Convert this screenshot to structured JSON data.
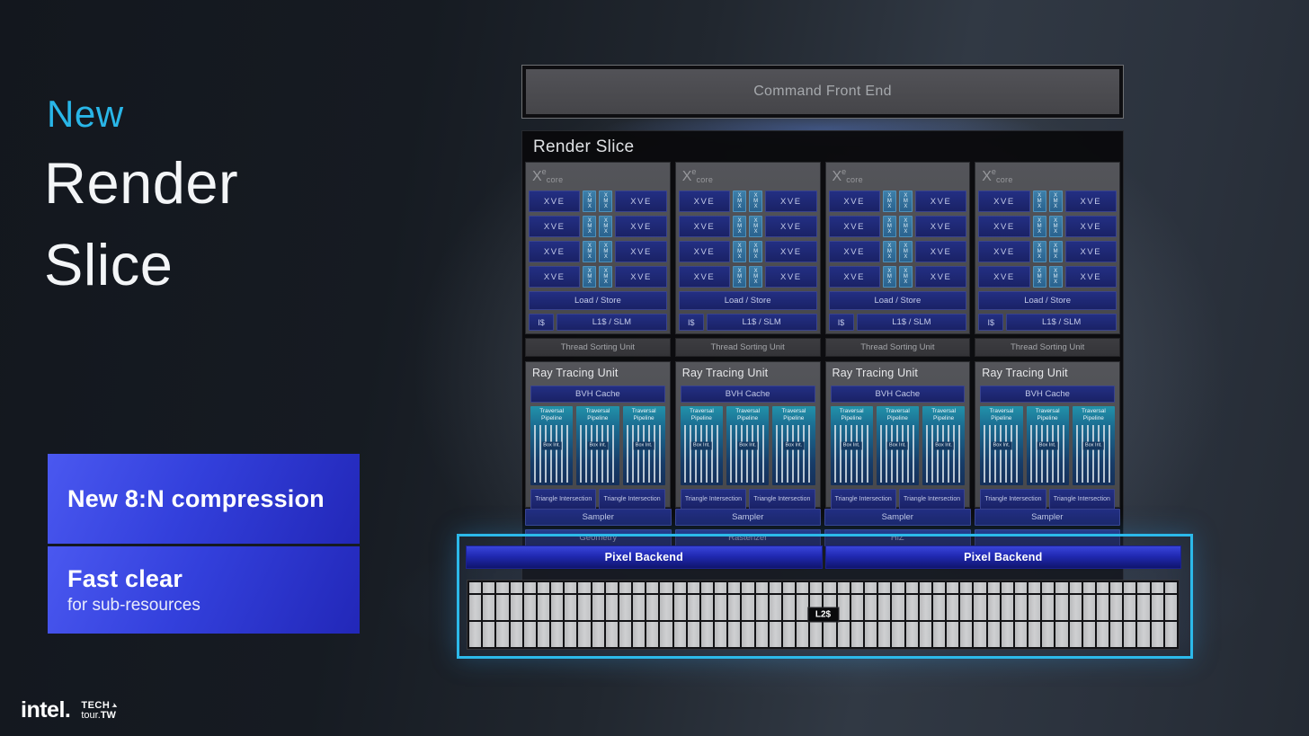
{
  "slide": {
    "eyebrow": "New",
    "title_line1": "Render",
    "title_line2": "Slice",
    "callouts": [
      {
        "title": "New 8:N compression"
      },
      {
        "title": "Fast clear",
        "subtitle": "for sub-resources"
      }
    ],
    "footer": {
      "intel_logo": "intel.",
      "tech": "TECH",
      "tour": "tour.",
      "tw": "TW"
    }
  },
  "colors": {
    "accent_cyan": "#29b6e8",
    "highlight_border": "#2cb9ea",
    "callout_blue_start": "#4a58f0",
    "callout_blue_end": "#2227b8",
    "unit_navy": "#1c2a74",
    "xmx_teal": "#34719d",
    "pipeline_teal": "#1b6d92",
    "pixel_backend_blue": "#2630bc",
    "l2_cell_gray": "#c6c7c9",
    "block_gray": "#4d4e52"
  },
  "diagram": {
    "command_front_end": "Command Front End",
    "render_slice_title": "Render Slice",
    "core_count": 4,
    "core": {
      "x": "X",
      "e": "e",
      "core": "core",
      "xve": "XVE",
      "xmx": "XMX",
      "xve_rows": 4,
      "load_store": "Load / Store",
      "icache": "I$",
      "l1_slm": "L1$ / SLM",
      "thread_sorting_unit": "Thread Sorting Unit",
      "ray_tracing_unit": "Ray Tracing Unit",
      "bvh_cache": "BVH Cache",
      "traversal_pipeline": "Traversal Pipeline",
      "traversal_count": 3,
      "box_int": "Box Int.",
      "triangle_intersection": "Triangle Intersection",
      "triangle_count": 2
    },
    "samplers": [
      "Sampler",
      "Sampler",
      "Sampler",
      "Sampler"
    ],
    "geometry_row": [
      "Geometry",
      "Rasterizer",
      "HiZ",
      ""
    ],
    "pixel_backend": [
      "Pixel Backend",
      "Pixel Backend"
    ],
    "l2": {
      "label": "L2$",
      "columns": 52,
      "rows": 3
    }
  }
}
